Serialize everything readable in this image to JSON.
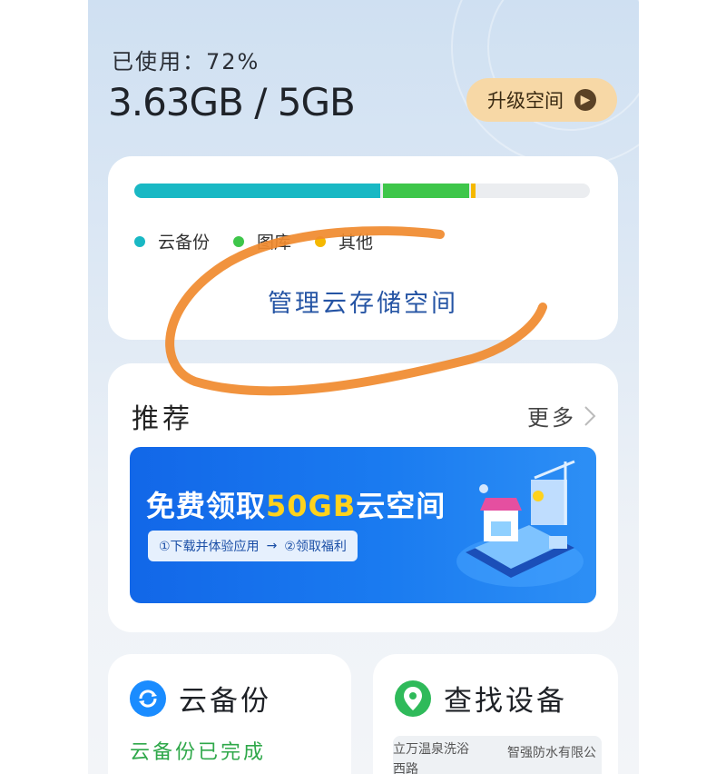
{
  "header": {
    "used_label": "已使用：72%",
    "used_amount": "3.63GB / 5GB",
    "upgrade_button": "升级空间"
  },
  "storage": {
    "segments": [
      {
        "name": "云备份",
        "fraction": 0.54,
        "color": "#19b8c4"
      },
      {
        "name": "图库",
        "fraction": 0.19,
        "color": "#3ec64a"
      },
      {
        "name": "其他",
        "fraction": 0.01,
        "color": "#f5b800"
      }
    ],
    "legend": [
      "云备份",
      "图库",
      "其他"
    ],
    "manage_link": "管理云存储空间"
  },
  "recommend": {
    "title": "推荐",
    "more_link": "更多",
    "banner": {
      "title_prefix": "免费领取",
      "title_highlight": "50GB",
      "title_suffix": "云空间",
      "step1": "①下载并体验应用",
      "arrow": "→",
      "step2": "②领取福利"
    }
  },
  "tiles": {
    "backup": {
      "title": "云备份",
      "status": "云备份已完成"
    },
    "find_device": {
      "title": "查找设备",
      "map_labels": [
        "立万温泉洗浴",
        "智强防水有限公",
        "西路"
      ]
    }
  },
  "colors": {
    "accent": "#2554a4",
    "scribble": "#f08a2e"
  }
}
